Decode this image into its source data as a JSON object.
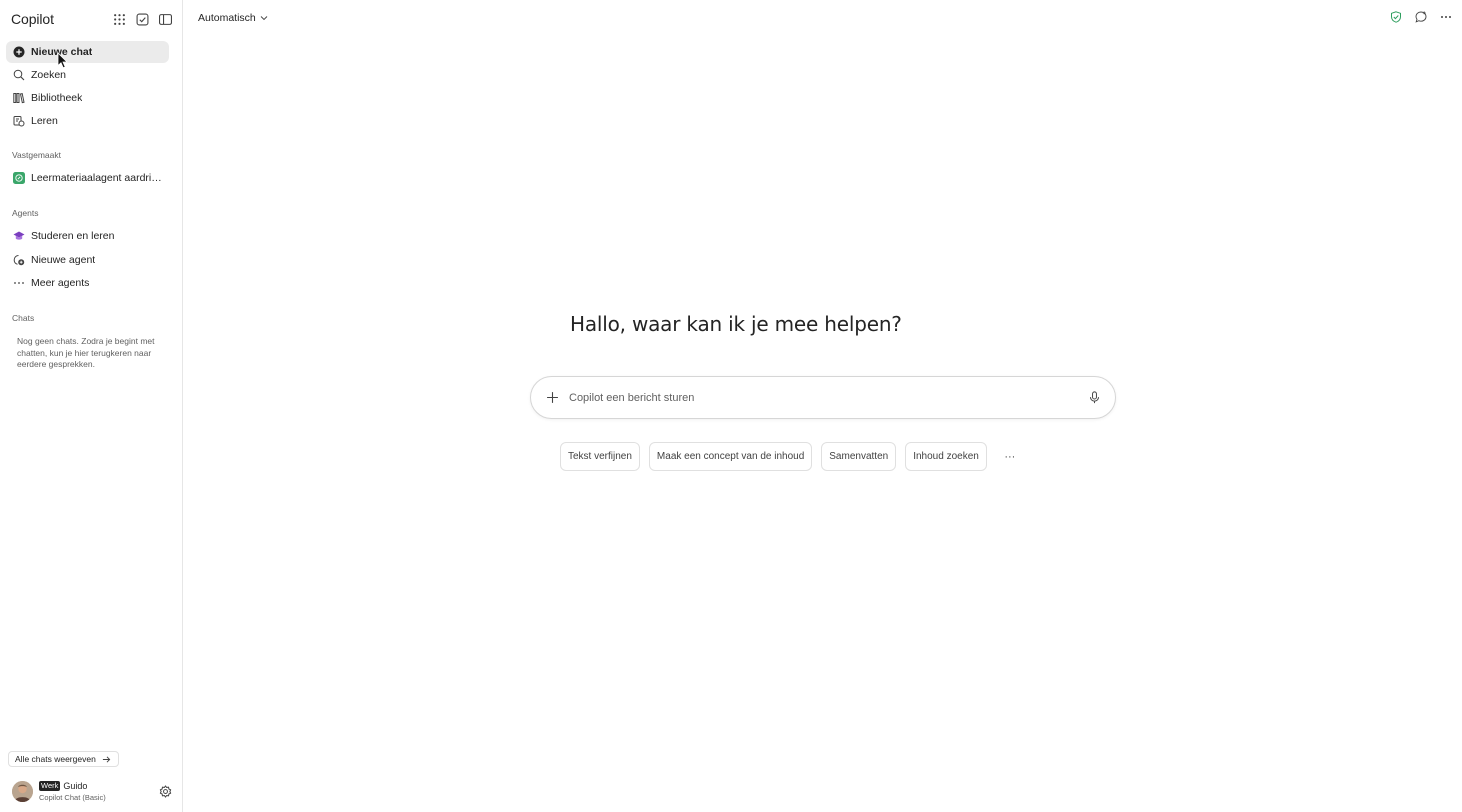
{
  "sidebar": {
    "title": "Copilot",
    "header_icons": [
      "apps-grid-icon",
      "tasks-check-icon",
      "sidebar-toggle-icon"
    ],
    "nav": [
      {
        "label": "Nieuwe chat",
        "icon": "new-chat-plus-icon",
        "active": true
      },
      {
        "label": "Zoeken",
        "icon": "search-icon"
      },
      {
        "label": "Bibliotheek",
        "icon": "library-icon"
      },
      {
        "label": "Leren",
        "icon": "learn-icon"
      }
    ],
    "pinned_label": "Vastgemaakt",
    "pinned": [
      {
        "label": "Leermateriaalagent aardrijk...",
        "icon": "agent-green-icon"
      }
    ],
    "agents_label": "Agents",
    "agents": [
      {
        "label": "Studeren en leren",
        "icon": "graduation-cap-icon"
      },
      {
        "label": "Nieuwe agent",
        "icon": "new-agent-icon"
      },
      {
        "label": "Meer agents",
        "icon": "more-dots-icon"
      }
    ],
    "chats_label": "Chats",
    "chats_empty": "Nog geen chats. Zodra je begint met chatten, kun je hier terugkeren naar eerdere gesprekken.",
    "all_chats_button": "Alle chats weergeven",
    "user": {
      "badge": "Werk",
      "name": "Guido",
      "plan": "Copilot Chat (Basic)"
    }
  },
  "topbar": {
    "model": "Automatisch",
    "right_icons": [
      "shield-check-icon",
      "new-chat-bubble-icon",
      "more-options-icon"
    ]
  },
  "main": {
    "greeting": "Hallo, waar kan ik je mee helpen?",
    "composer_placeholder": "Copilot een bericht sturen",
    "chips": [
      "Tekst verfijnen",
      "Maak een concept van de inhoud",
      "Samenvatten",
      "Inhoud zoeken"
    ],
    "chips_more": "···"
  },
  "colors": {
    "active_bg": "#ebebeb",
    "shield_green": "#2e9e5e",
    "agent_green": "#3aa66a",
    "agent_purple": "#7b3fbf"
  }
}
